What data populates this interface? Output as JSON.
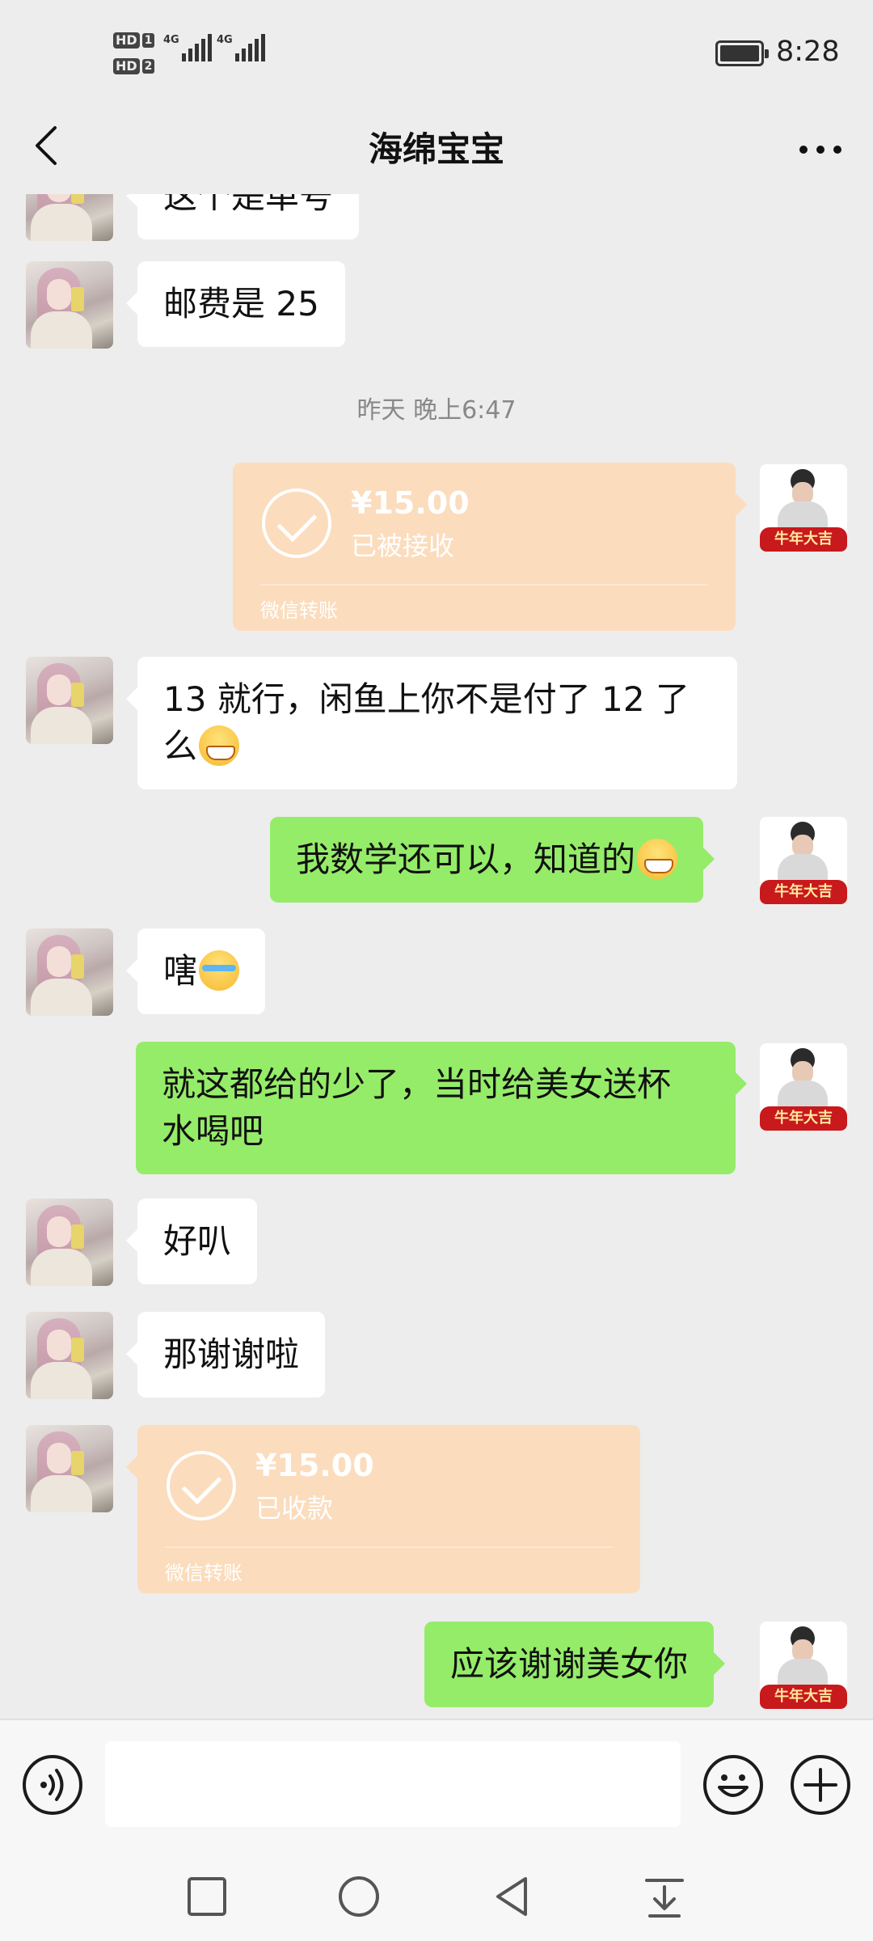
{
  "status_bar": {
    "sim1_label": "HD",
    "sim1_num": "1",
    "sim2_label": "HD",
    "sim2_num": "2",
    "net1": "4G",
    "net2": "4G",
    "time": "8:28"
  },
  "header": {
    "title": "海绵宝宝",
    "back_icon": "chevron-left-icon",
    "more_icon": "more-dots-icon"
  },
  "messages": [
    {
      "side": "left",
      "type": "text",
      "text": "这个是单号"
    },
    {
      "side": "left",
      "type": "text",
      "text": "邮费是 25"
    },
    {
      "type": "timestamp",
      "text": "昨天 晚上6:47"
    },
    {
      "side": "right",
      "type": "transfer",
      "amount": "¥15.00",
      "status": "已被接收",
      "footer": "微信转账"
    },
    {
      "side": "left",
      "type": "text",
      "text_line1": "13 就行，闲鱼上你不是付了 12 了",
      "text_line2": "么",
      "emoji": "grin-emoji"
    },
    {
      "side": "right",
      "type": "text",
      "text": "我数学还可以，知道的",
      "emoji": "grin-emoji"
    },
    {
      "side": "left",
      "type": "text",
      "text": "嗐",
      "emoji": "laugh-cry-emoji"
    },
    {
      "side": "right",
      "type": "text",
      "text_line1": "就这都给的少了，当时给美女送杯",
      "text_line2": "水喝吧"
    },
    {
      "side": "left",
      "type": "text",
      "text": "好叭"
    },
    {
      "side": "left",
      "type": "text",
      "text": "那谢谢啦"
    },
    {
      "side": "left",
      "type": "transfer",
      "amount": "¥15.00",
      "status": "已收款",
      "footer": "微信转账"
    },
    {
      "side": "right",
      "type": "text",
      "text": "应该谢谢美女你"
    }
  ],
  "avatar_right_banner": "牛年大吉",
  "input_bar": {
    "placeholder": "",
    "voice_icon": "voice-icon",
    "emoji_icon": "smiley-icon",
    "plus_icon": "plus-icon"
  },
  "nav_bar": {
    "items": [
      "square-icon",
      "circle-icon",
      "triangle-back-icon",
      "notification-pull-icon"
    ]
  },
  "colors": {
    "background": "#ededed",
    "bubble_sent": "#95ec69",
    "bubble_received": "#ffffff",
    "transfer_card": "#fbdcbd"
  }
}
